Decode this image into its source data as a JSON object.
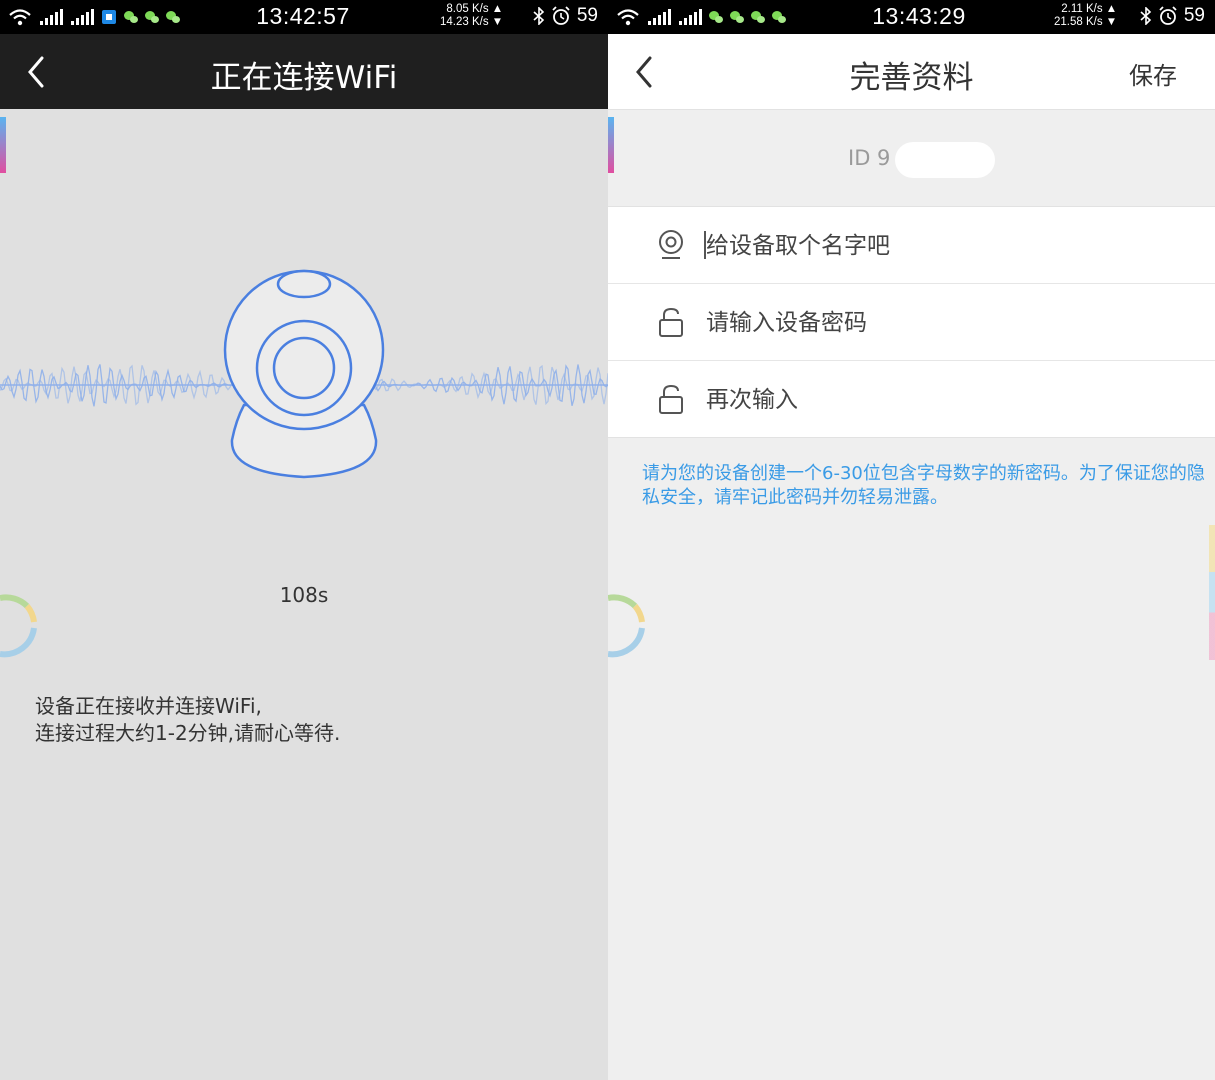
{
  "left": {
    "status": {
      "time": "13:42:57",
      "speed_up": "8.05 K/s ▲",
      "speed_down": "14.23 K/s ▼",
      "battery": "59"
    },
    "header": {
      "title": "正在连接WiFi"
    },
    "timer": "108s",
    "instructions": [
      "设备正在接收并连接WiFi,",
      "连接过程大约1-2分钟,请耐心等待."
    ]
  },
  "right": {
    "status": {
      "time": "13:43:29",
      "speed_up": "2.11 K/s ▲",
      "speed_down": "21.58 K/s ▼",
      "battery": "59"
    },
    "header": {
      "title": "完善资料",
      "save_label": "保存"
    },
    "device_id": "ID 9",
    "fields": [
      {
        "icon": "camera-location-icon",
        "placeholder": "给设备取个名字吧"
      },
      {
        "icon": "lock-icon",
        "placeholder": "请输入设备密码"
      },
      {
        "icon": "lock-icon",
        "placeholder": "再次输入"
      }
    ],
    "hint": "请为您的设备创建一个6-30位包含字母数字的新密码。为了保证您的隐私安全，请牢记此密码并勿轻易泄露。"
  },
  "colors": {
    "accent_blue": "#3a9be6",
    "illustration_blue": "#4a7fe0",
    "dark_header": "#1f1f1f"
  }
}
